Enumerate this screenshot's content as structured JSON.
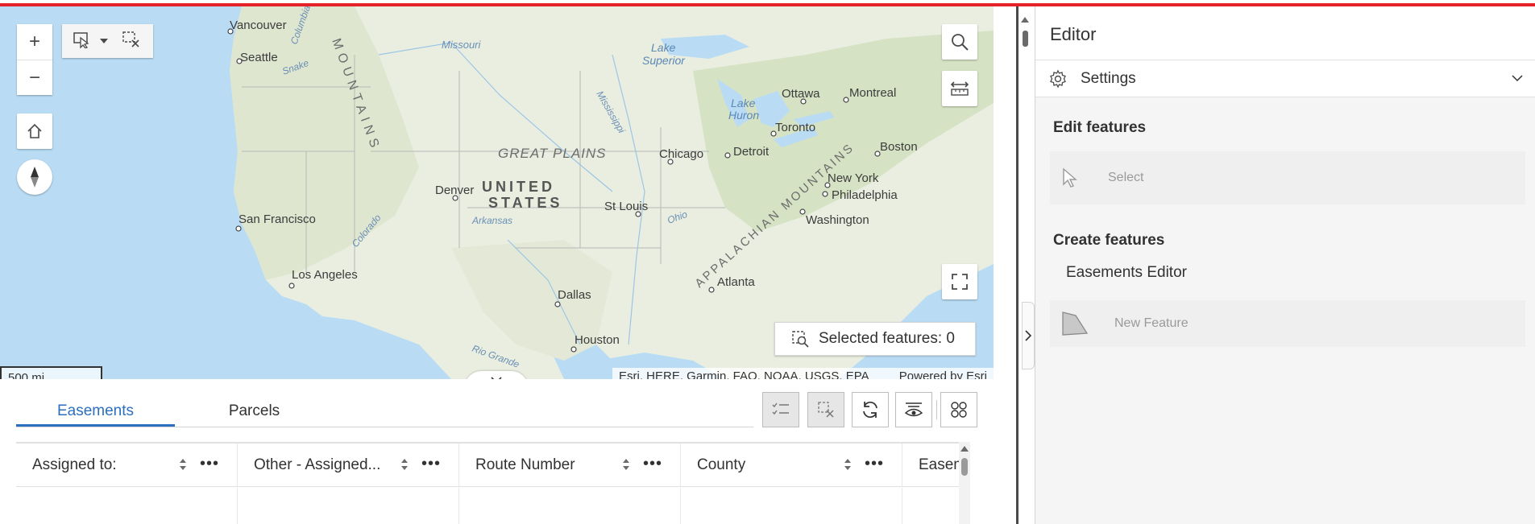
{
  "map": {
    "labels": {
      "vancouver": "Vancouver",
      "seattle": "Seattle",
      "missouri": "Missouri",
      "lake_superior_1": "Lake",
      "lake_superior_2": "Superior",
      "ottawa": "Ottawa",
      "montreal": "Montreal",
      "lake_huron_1": "Lake",
      "lake_huron_2": "Huron",
      "toronto": "Toronto",
      "mountains": "MOUNTAINS",
      "columbia": "Columbia",
      "snake": "Snake",
      "mississippi": "Mississippi",
      "boston": "Boston",
      "great_plains": "GREAT PLAINS",
      "chicago": "Chicago",
      "detroit": "Detroit",
      "new_york": "New York",
      "denver": "Denver",
      "united": "UNITED",
      "states": "STATES",
      "philadelphia": "Philadelphia",
      "st_louis": "St Louis",
      "arkansas": "Arkansas",
      "ohio": "Ohio",
      "washington": "Washington",
      "san_francisco": "San Francisco",
      "colorado": "Colorado",
      "appalachian": "APPALACHIAN MOUNTAINS",
      "los_angeles": "Los Angeles",
      "atlanta": "Atlanta",
      "dallas": "Dallas",
      "rio_grande": "Rio Grande",
      "houston": "Houston"
    },
    "selected_features": "Selected features: 0",
    "scale": "500 mi",
    "attribution": "Esri, HERE, Garmin, FAO, NOAA, USGS, EPA",
    "powered_by": "Powered by Esri"
  },
  "table": {
    "tabs": [
      "Easements",
      "Parcels"
    ],
    "columns": [
      "Assigned to:",
      "Other - Assigned...",
      "Route Number",
      "County",
      "Easem"
    ]
  },
  "editor": {
    "title": "Editor",
    "settings_label": "Settings",
    "edit_features_heading": "Edit features",
    "select_label": "Select",
    "create_features_heading": "Create features",
    "layer_name": "Easements Editor",
    "new_feature_label": "New Feature"
  }
}
